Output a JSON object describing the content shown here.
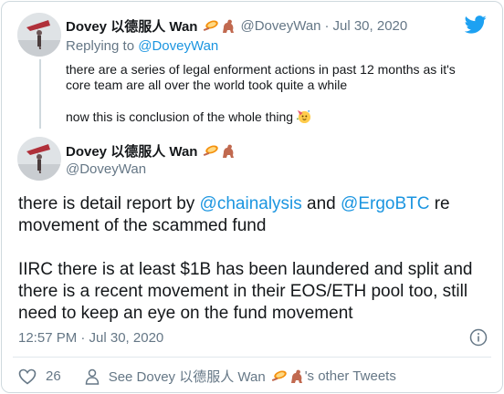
{
  "reply_tweet": {
    "display_name": "Dovey 以德服人 Wan",
    "name_emojis": [
      "tennis-racket-emoji",
      "dinosaur-emoji"
    ],
    "handle": "@DoveyWan",
    "separator": "·",
    "date": "Jul 30, 2020",
    "replying_prefix": "Replying to",
    "replying_to": "@DoveyWan",
    "text_line1": "there are a series of legal enforment actions in past 12 months as it's core team are all over the world took quite a while",
    "text_line2": "now this is conclusion of the whole thing",
    "text_emoji": "party-face-emoji"
  },
  "main_tweet": {
    "display_name": "Dovey 以德服人 Wan",
    "name_emojis": [
      "tennis-racket-emoji",
      "dinosaur-emoji"
    ],
    "handle": "@DoveyWan",
    "para1_a": "there is detail report by ",
    "mention1": "@chainalysis",
    "para1_b": " and ",
    "mention2": "@ErgoBTC",
    "para1_c": " re movement of the scammed fund",
    "para2": "IIRC there is at least $1B has been laundered and split and there is a recent movement in their EOS/ETH pool too, still need to keep an eye on the fund movement",
    "timestamp": "12:57 PM · Jul 30, 2020"
  },
  "actions": {
    "like_count": "26",
    "see_prefix": "See Dovey 以德服人 Wan",
    "see_suffix": "'s other Tweets"
  },
  "colors": {
    "link": "#1b95e0",
    "muted": "#657786",
    "border": "#cfd9de",
    "twitter_blue": "#1da1f2"
  }
}
